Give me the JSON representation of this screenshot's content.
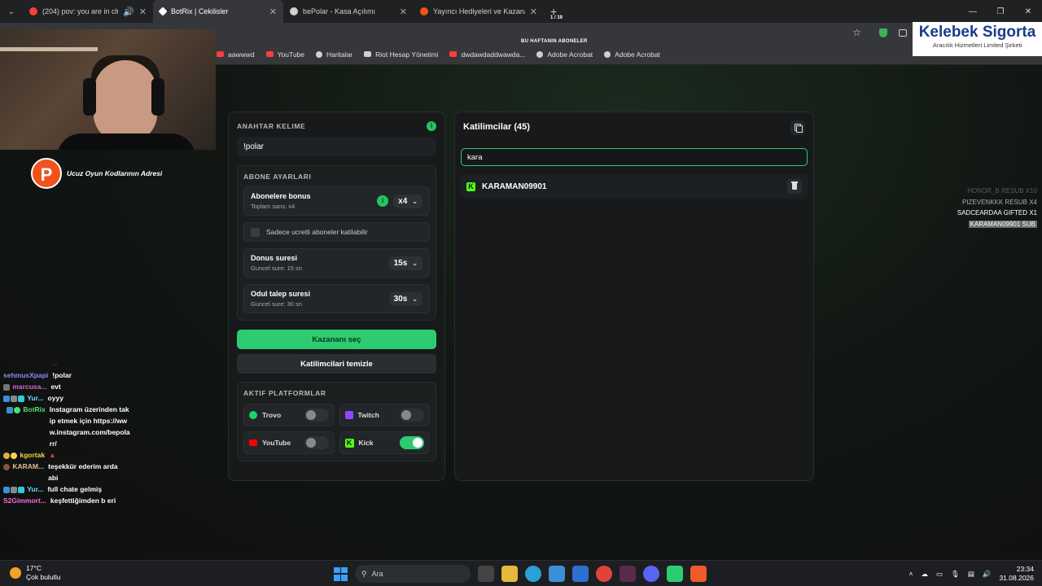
{
  "browser": {
    "tabs": [
      {
        "title": "(204) pov: you are in club a",
        "color": "#ff3d3d",
        "active": false
      },
      {
        "title": "BotRix | Cekilisler",
        "color": "#ffffff",
        "active": true
      },
      {
        "title": "bePolar - Kasa Açılımı",
        "color": "#cfcfcf",
        "active": false
      },
      {
        "title": "Yayıncı Hediyeleri ve Kazananla",
        "color": "#f0521c",
        "active": false
      }
    ],
    "bookmarks": [
      {
        "label": "aawwwd",
        "color": "#ff3d3d"
      },
      {
        "label": "YouTube",
        "color": "#ff3d3d"
      },
      {
        "label": "Haritalar",
        "color": "#cfcfcf"
      },
      {
        "label": "Riot Hesap Yönetimi",
        "color": "#cfcfcf"
      },
      {
        "label": "dwdawdaddwawda...",
        "color": "#ff3d3d"
      },
      {
        "label": "Adobe Acrobat",
        "color": "#cfcfcf"
      },
      {
        "label": "Adobe Acrobat",
        "color": "#cfcfcf"
      }
    ]
  },
  "overlay": {
    "promo_text": "Ucuz Oyun Kodlarının Adresi",
    "promo_letter": "P",
    "sponsor_title": "Kelebek Sigorta",
    "sponsor_sub": "Aracılık Hizmetleri Limited Şirketi",
    "subs_header": "BU HAFTANIN ABONELER",
    "pager": "1 / 19",
    "subs": [
      "HONOR_B RESUB X10",
      "PIZEVENKKK RESUB X4",
      "SADCEARDAA GIFTED X1",
      "KARAMAN09901 SUB"
    ],
    "chat_faded": "...",
    "chat": [
      {
        "user": "sehmusXpapi",
        "msg": "!polar",
        "color": "#8a8aff"
      },
      {
        "user": "marcusa...",
        "msg": "evt",
        "color": "#d36ad6"
      },
      {
        "user": "Yur...",
        "msg": "oyyy",
        "color": "#7fd6ff"
      },
      {
        "user": "BotRix",
        "msg": "Instagram üzerinden takip etmek için https://www.instagram.com/bepolarr/",
        "color": "#4ee06a"
      },
      {
        "user": "kgortak",
        "msg": "",
        "color": "#ffd24a"
      },
      {
        "user": "KARAM...",
        "msg": "teşekkür ederim arda abi",
        "color": "#e0c090"
      },
      {
        "user": "Yur...",
        "msg": "full chate gelmiş",
        "color": "#7fd6ff"
      },
      {
        "user": "S2Gimmort...",
        "msg": "keşfettiğimden b eri",
        "color": "#ff6ad5"
      }
    ]
  },
  "left_panel": {
    "keyword_label": "ANAHTAR KELIME",
    "keyword_value": "!polar",
    "sub_settings_label": "ABONE AYARLARI",
    "bonus_title": "Abonelere bonus",
    "bonus_sub": "Toplam sans: x4",
    "bonus_value": "x4",
    "paid_only_label": "Sadece ucretli aboneler katilabilir",
    "bonus_time_title": "Donus suresi",
    "bonus_time_sub": "Guncel sure: 15 sn",
    "bonus_time_value": "15s",
    "claim_title": "Odul talep suresi",
    "claim_sub": "Guncel sure: 30 sn",
    "claim_value": "30s",
    "pick_winner": "Kazananı seç",
    "clear_participants": "Katilimcilari temizle",
    "platforms_label": "AKTIF PLATFORMLAR",
    "platforms": [
      {
        "name": "Trovo",
        "color": "#19d66b",
        "enabled": false
      },
      {
        "name": "Twitch",
        "color": "#9146ff",
        "enabled": false
      },
      {
        "name": "YouTube",
        "color": "#ff0000",
        "enabled": false
      },
      {
        "name": "Kick",
        "color": "#53fc18",
        "enabled": true
      }
    ]
  },
  "right_panel": {
    "title": "Katilimcilar (45)",
    "search_value": "kara",
    "entries": [
      {
        "name": "KARAMAN09901",
        "platform": "Kick"
      }
    ]
  },
  "taskbar": {
    "temp": "17°C",
    "weather": "Çok bulutlu",
    "search": "Ara",
    "time": "23:34",
    "date": "31.08.2026"
  }
}
